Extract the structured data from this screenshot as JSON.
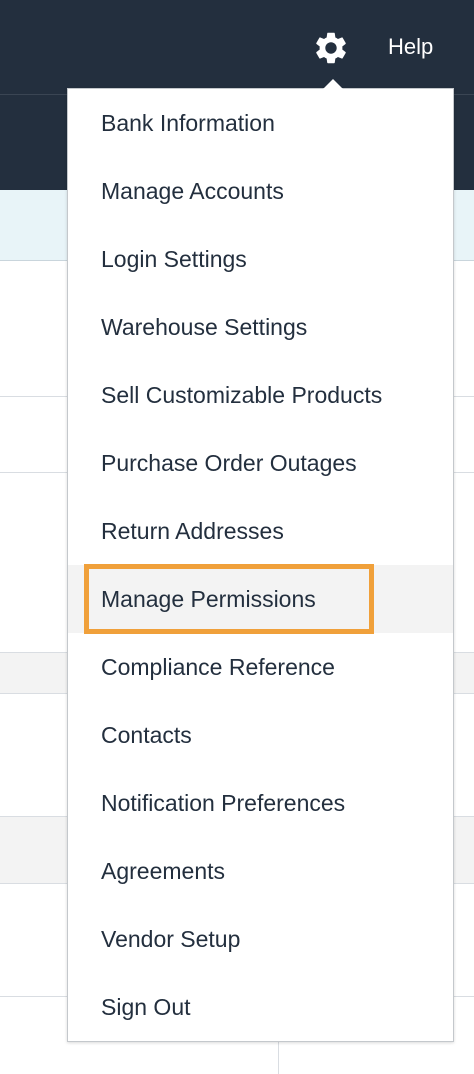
{
  "header": {
    "help_label": "Help",
    "settings_icon": "gear-icon"
  },
  "settings_menu": {
    "items": [
      {
        "label": "Bank Information"
      },
      {
        "label": "Manage Accounts"
      },
      {
        "label": "Login Settings"
      },
      {
        "label": "Warehouse Settings"
      },
      {
        "label": "Sell Customizable Products"
      },
      {
        "label": "Purchase Order Outages"
      },
      {
        "label": "Return Addresses"
      },
      {
        "label": "Manage Permissions",
        "hovered": true,
        "highlighted": true
      },
      {
        "label": "Compliance Reference"
      },
      {
        "label": "Contacts"
      },
      {
        "label": "Notification Preferences"
      },
      {
        "label": "Agreements"
      },
      {
        "label": "Vendor Setup"
      },
      {
        "label": "Sign Out"
      }
    ]
  },
  "colors": {
    "nav_background": "#232f3e",
    "menu_text": "#232f3e",
    "highlight_outline": "#f0a03a",
    "hover_background": "#f3f3f3"
  }
}
